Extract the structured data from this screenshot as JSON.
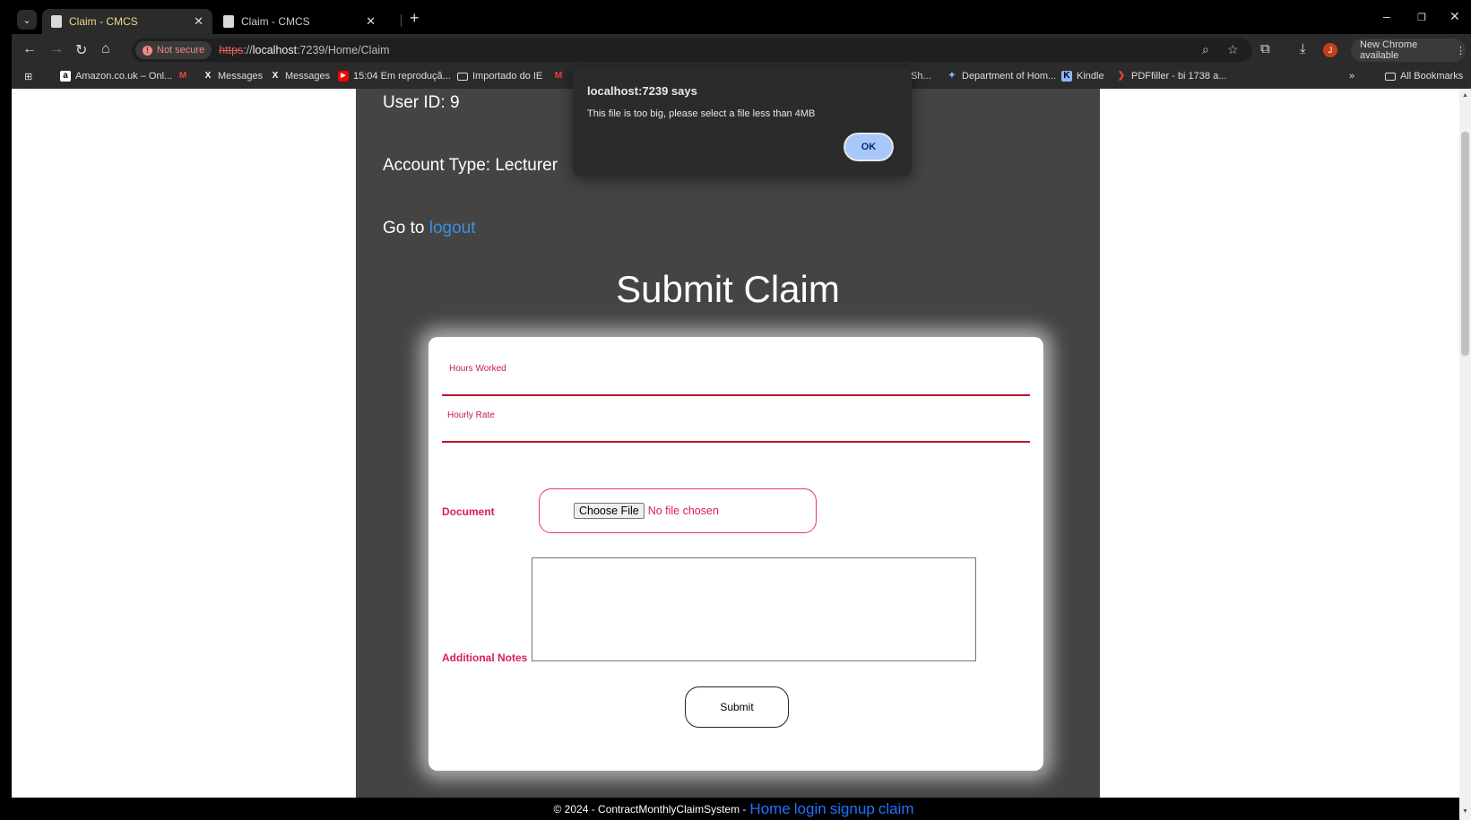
{
  "browser": {
    "tabs": [
      {
        "title": "Claim - CMCS",
        "active": true
      },
      {
        "title": "Claim - CMCS",
        "active": false
      }
    ],
    "address": {
      "security_label": "Not secure",
      "url_scheme": "https",
      "url_sep": "://",
      "url_host": "localhost",
      "url_rest": ":7239/Home/Claim"
    },
    "update_label": "New Chrome available",
    "profile_initial": "J",
    "bookmarks": [
      {
        "label": "Amazon.co.uk – Onl...",
        "icon": "amazon-icon"
      },
      {
        "label": "",
        "icon": "gmail-icon"
      },
      {
        "label": "Messages",
        "icon": "x-icon"
      },
      {
        "label": "Messages",
        "icon": "x-icon"
      },
      {
        "label": "15:04 Em reproduçã...",
        "icon": "youtube-icon"
      },
      {
        "label": "Importado do IE",
        "icon": "folder-icon"
      },
      {
        "label": "Sh...",
        "icon": "gmail-icon"
      },
      {
        "label": "Department of Hom...",
        "icon": "department-icon"
      },
      {
        "label": "Kindle",
        "icon": "kindle-icon"
      },
      {
        "label": "PDFfiller - bi 1738 a...",
        "icon": "pdffiller-icon"
      }
    ],
    "bookmarks_overflow": "»",
    "all_bookmarks": "All Bookmarks"
  },
  "user": {
    "id_line": "User ID: 9",
    "account_line": "Account Type: Lecturer",
    "goto_text": "Go to ",
    "logout_link": "logout"
  },
  "form": {
    "heading": "Submit Claim",
    "hours_label": "Hours Worked",
    "hours_value": "",
    "rate_label": "Hourly Rate",
    "rate_value": "",
    "document_label": "Document",
    "choose_file_label": "Choose File",
    "no_file_text": "No file chosen",
    "notes_label": "Additional Notes",
    "notes_value": "",
    "submit_label": "Submit"
  },
  "footer": {
    "copyright": "© 2024 - ContractMonthlyClaimSystem -",
    "links": [
      "Home",
      "login",
      "signup",
      "claim"
    ]
  },
  "dialog": {
    "title": "localhost:7239 says",
    "message": "This file is too big, please select a file less than 4MB",
    "ok_label": "OK"
  },
  "colors": {
    "panel_bg": "#444444",
    "accent_red": "#d81b60",
    "link_blue": "#3c8ee0",
    "footer_link_blue": "#1e73ff",
    "dialog_button": "#a8c7fa"
  }
}
